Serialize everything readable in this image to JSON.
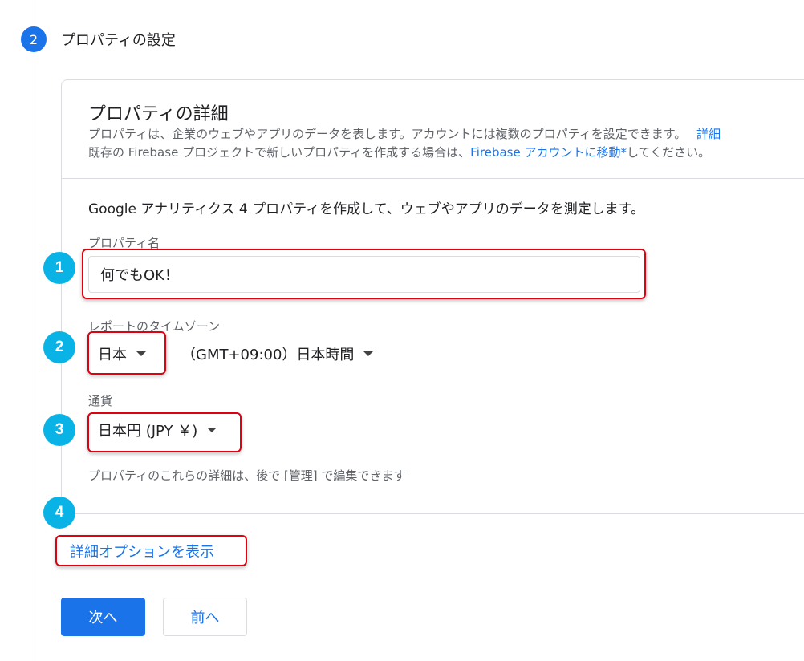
{
  "step": {
    "number": "2",
    "title": "プロパティの設定"
  },
  "card": {
    "title": "プロパティの詳細",
    "desc_line1": "プロパティは、企業のウェブやアプリのデータを表します。アカウントには複数のプロパティを設定できます。",
    "desc_line1_link": "詳細",
    "desc_line2_prefix": "既存の Firebase プロジェクトで新しいプロパティを作成する場合は、",
    "desc_line2_link": "Firebase アカウントに移動*",
    "desc_line2_suffix": "してください。",
    "intro": "Google アナリティクス 4 プロパティを作成して、ウェブやアプリのデータを測定します。"
  },
  "form": {
    "property_name_label": "プロパティ名",
    "property_name_value": "何でもOK！",
    "timezone_label": "レポートのタイムゾーン",
    "timezone_country": "日本",
    "timezone_value": "（GMT+09:00）日本時間",
    "currency_label": "通貨",
    "currency_value": "日本円 (JPY ￥)",
    "note": "プロパティのこれらの詳細は、後で [管理] で編集できます"
  },
  "advanced_options_link": "詳細オプションを表示",
  "buttons": {
    "next": "次へ",
    "back": "前へ"
  },
  "annotations": {
    "badge1": "1",
    "badge2": "2",
    "badge3": "3",
    "badge4": "4"
  },
  "colors": {
    "accent": "#1a73e8",
    "highlight": "#e0000f",
    "badge": "#09b3e6"
  }
}
